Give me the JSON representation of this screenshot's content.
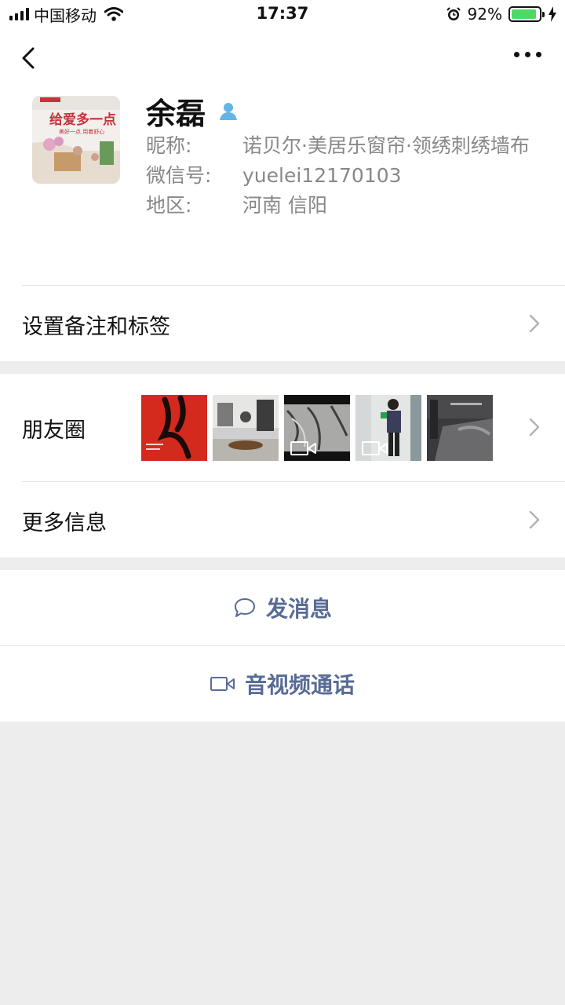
{
  "status_bar": {
    "carrier": "中国移动",
    "time": "17:37",
    "battery_percent": "92%",
    "battery_level": 0.92
  },
  "profile": {
    "name": "余磊",
    "nickname_label": "昵称:",
    "nickname": "诺贝尔·美居乐窗帘·领绣刺绣墙布",
    "wechat_id_label": "微信号:",
    "wechat_id": "yuelei12170103",
    "region_label": "地区:",
    "region": "河南 信阳",
    "avatar_text_main": "给爱多一点",
    "avatar_text_sub": "美好一点 用着舒心"
  },
  "rows": {
    "remark_label": "设置备注和标签",
    "moments_label": "朋友圈",
    "more_info_label": "更多信息"
  },
  "actions": {
    "message_label": "发消息",
    "call_label": "音视频通话"
  },
  "colors": {
    "link": "#576b95",
    "battery": "#4cd964",
    "badge": "#64b5e6"
  }
}
